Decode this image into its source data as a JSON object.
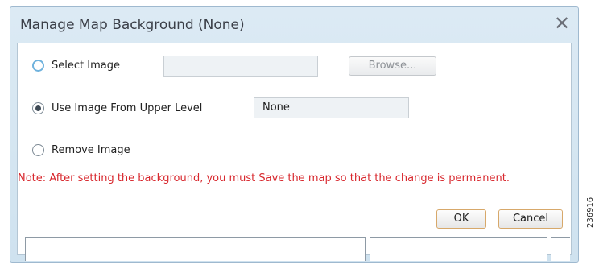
{
  "dialog": {
    "title": "Manage Map Background (None)",
    "close_glyph": "✕"
  },
  "options": {
    "select_image": {
      "label": "Select Image",
      "selected": false,
      "path_value": "",
      "browse_label": "Browse..."
    },
    "upper_level": {
      "label": "Use Image From Upper Level",
      "selected": true,
      "value": "None"
    },
    "remove_image": {
      "label": "Remove Image",
      "selected": false
    }
  },
  "note": "Note: After setting the background, you must Save the map so that the change is permanent.",
  "buttons": {
    "ok": "OK",
    "cancel": "Cancel"
  },
  "figure_id": "236916",
  "colors": {
    "note": "#d8282e",
    "title_bg": "#cfe2ef",
    "button_border": "#d7a86a"
  }
}
